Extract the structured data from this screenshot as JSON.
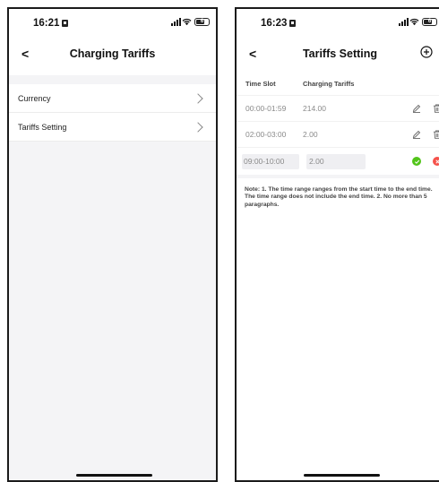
{
  "left_screen": {
    "status": {
      "time": "16:21",
      "battery": "6"
    },
    "nav": {
      "back": "<",
      "title": "Charging Tariffs"
    },
    "menu": [
      {
        "label": "Currency"
      },
      {
        "label": "Tariffs Setting"
      }
    ]
  },
  "right_screen": {
    "status": {
      "time": "16:23",
      "battery": "6"
    },
    "nav": {
      "back": "<",
      "title": "Tariffs Setting",
      "add_icon": "plus-circle-icon"
    },
    "table": {
      "headers": {
        "time_slot": "Time Slot",
        "tariff": "Charging Tariffs"
      },
      "rows": [
        {
          "time_slot": "00:00-01:59",
          "tariff": "214.00",
          "actions": [
            "edit-icon",
            "trash-icon"
          ]
        },
        {
          "time_slot": "02:00-03:00",
          "tariff": "2.00",
          "actions": [
            "edit-icon",
            "trash-icon"
          ]
        }
      ],
      "editing_row": {
        "time_slot": "09:00-10:00",
        "tariff": "2.00",
        "actions": [
          "confirm-icon",
          "cancel-icon"
        ]
      }
    },
    "note": "Note: 1. The time range ranges from the start time to the end time. The time range does not include the end time. 2. No more than 5 paragraphs."
  },
  "colors": {
    "confirm": "#52c41a",
    "cancel": "#f5524b",
    "background": "#f4f4f6"
  }
}
